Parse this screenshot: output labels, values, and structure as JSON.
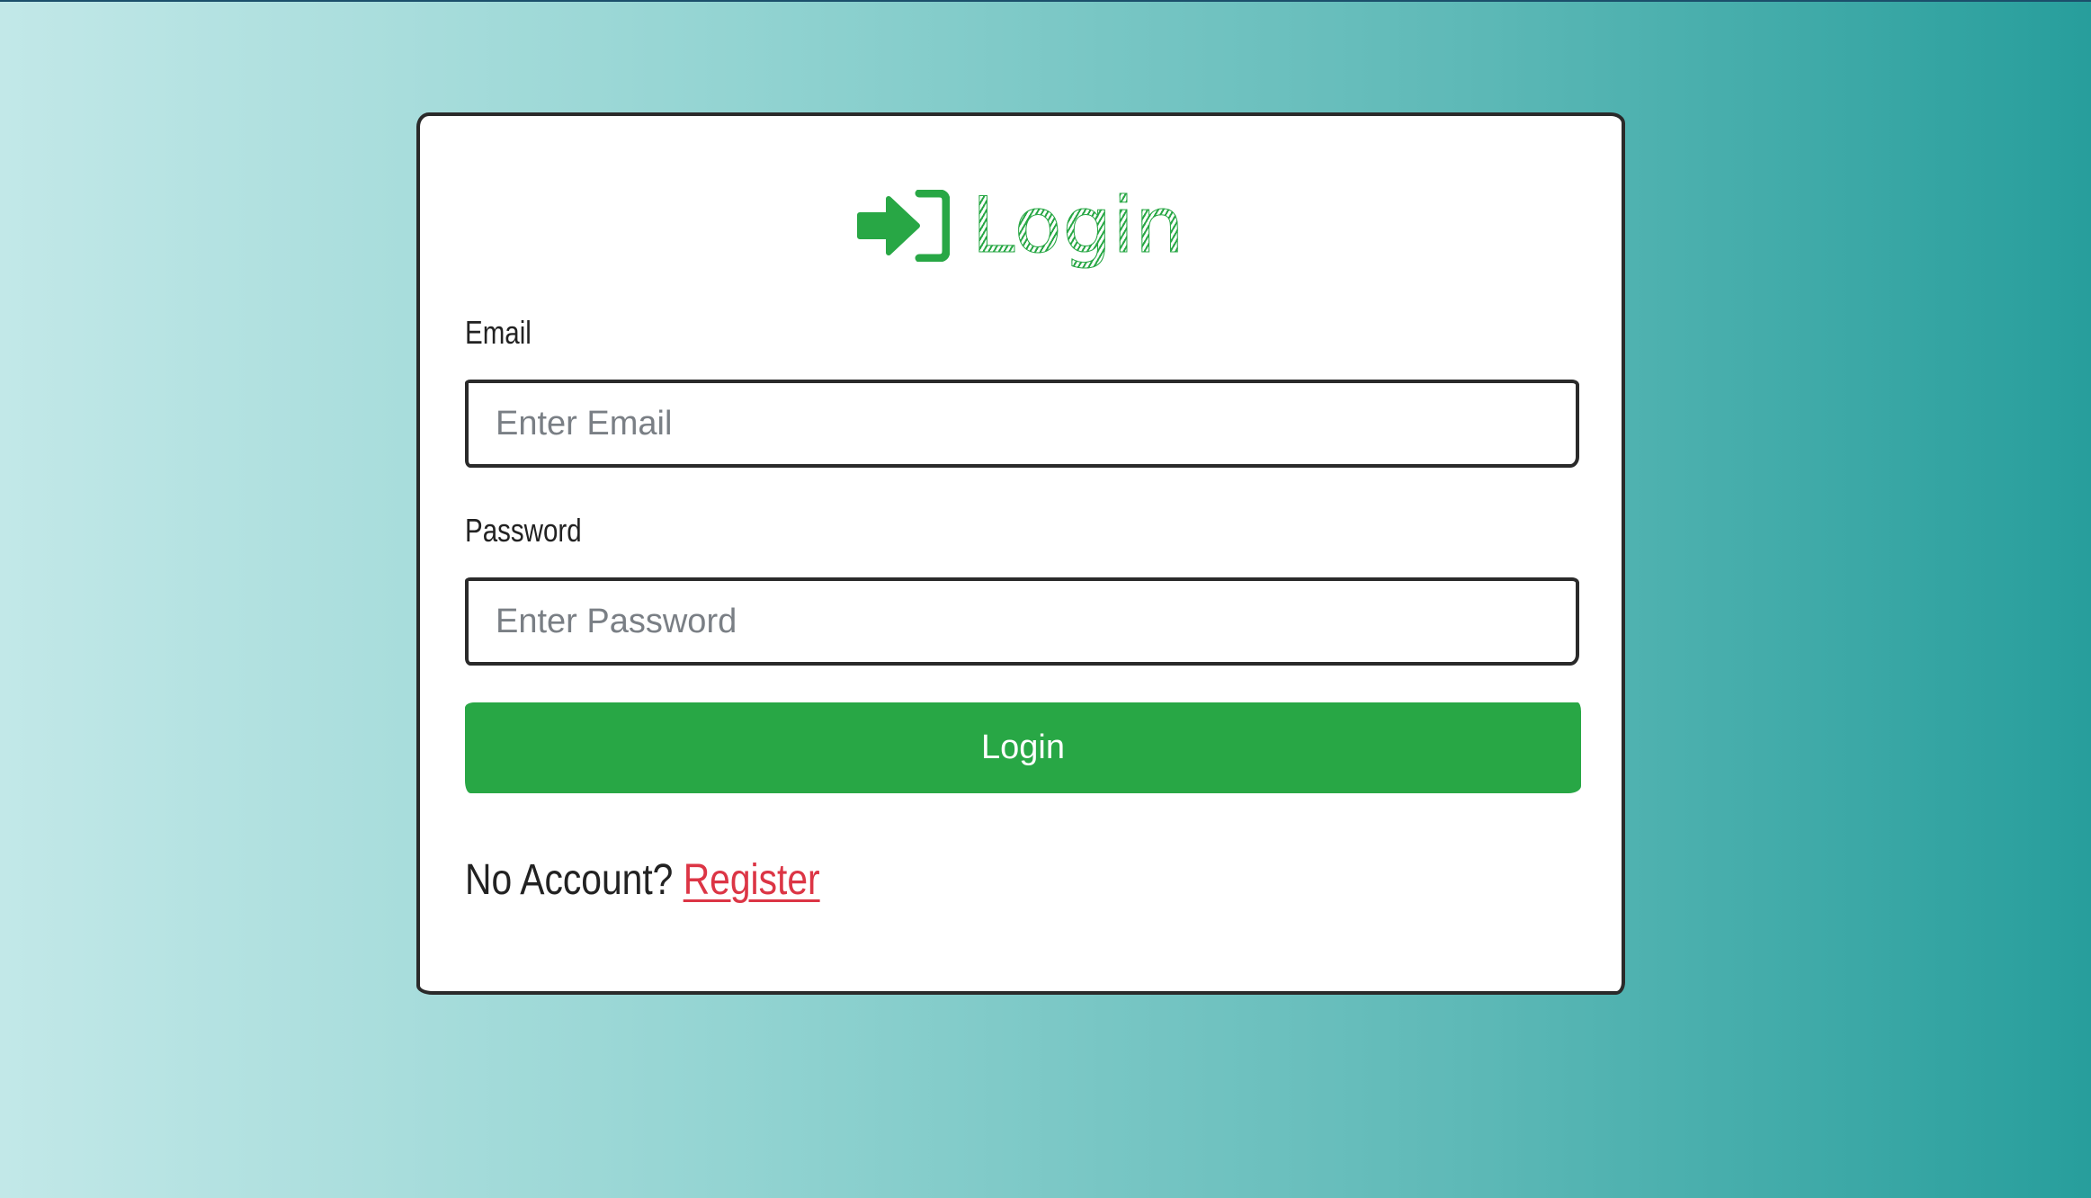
{
  "login_card": {
    "title": "Login",
    "title_icon": "sign-in-icon",
    "email_label": "Email",
    "email_placeholder": "Enter Email",
    "email_value": "",
    "password_label": "Password",
    "password_placeholder": "Enter Password",
    "password_value": "",
    "submit_label": "Login",
    "no_account_text": "No Account?",
    "register_link": "Register"
  },
  "colors": {
    "accent": "#28a745",
    "link": "#dc3545",
    "background_start": "#c2e8e8",
    "background_end": "#279e9c",
    "border": "#2a2a2a"
  }
}
